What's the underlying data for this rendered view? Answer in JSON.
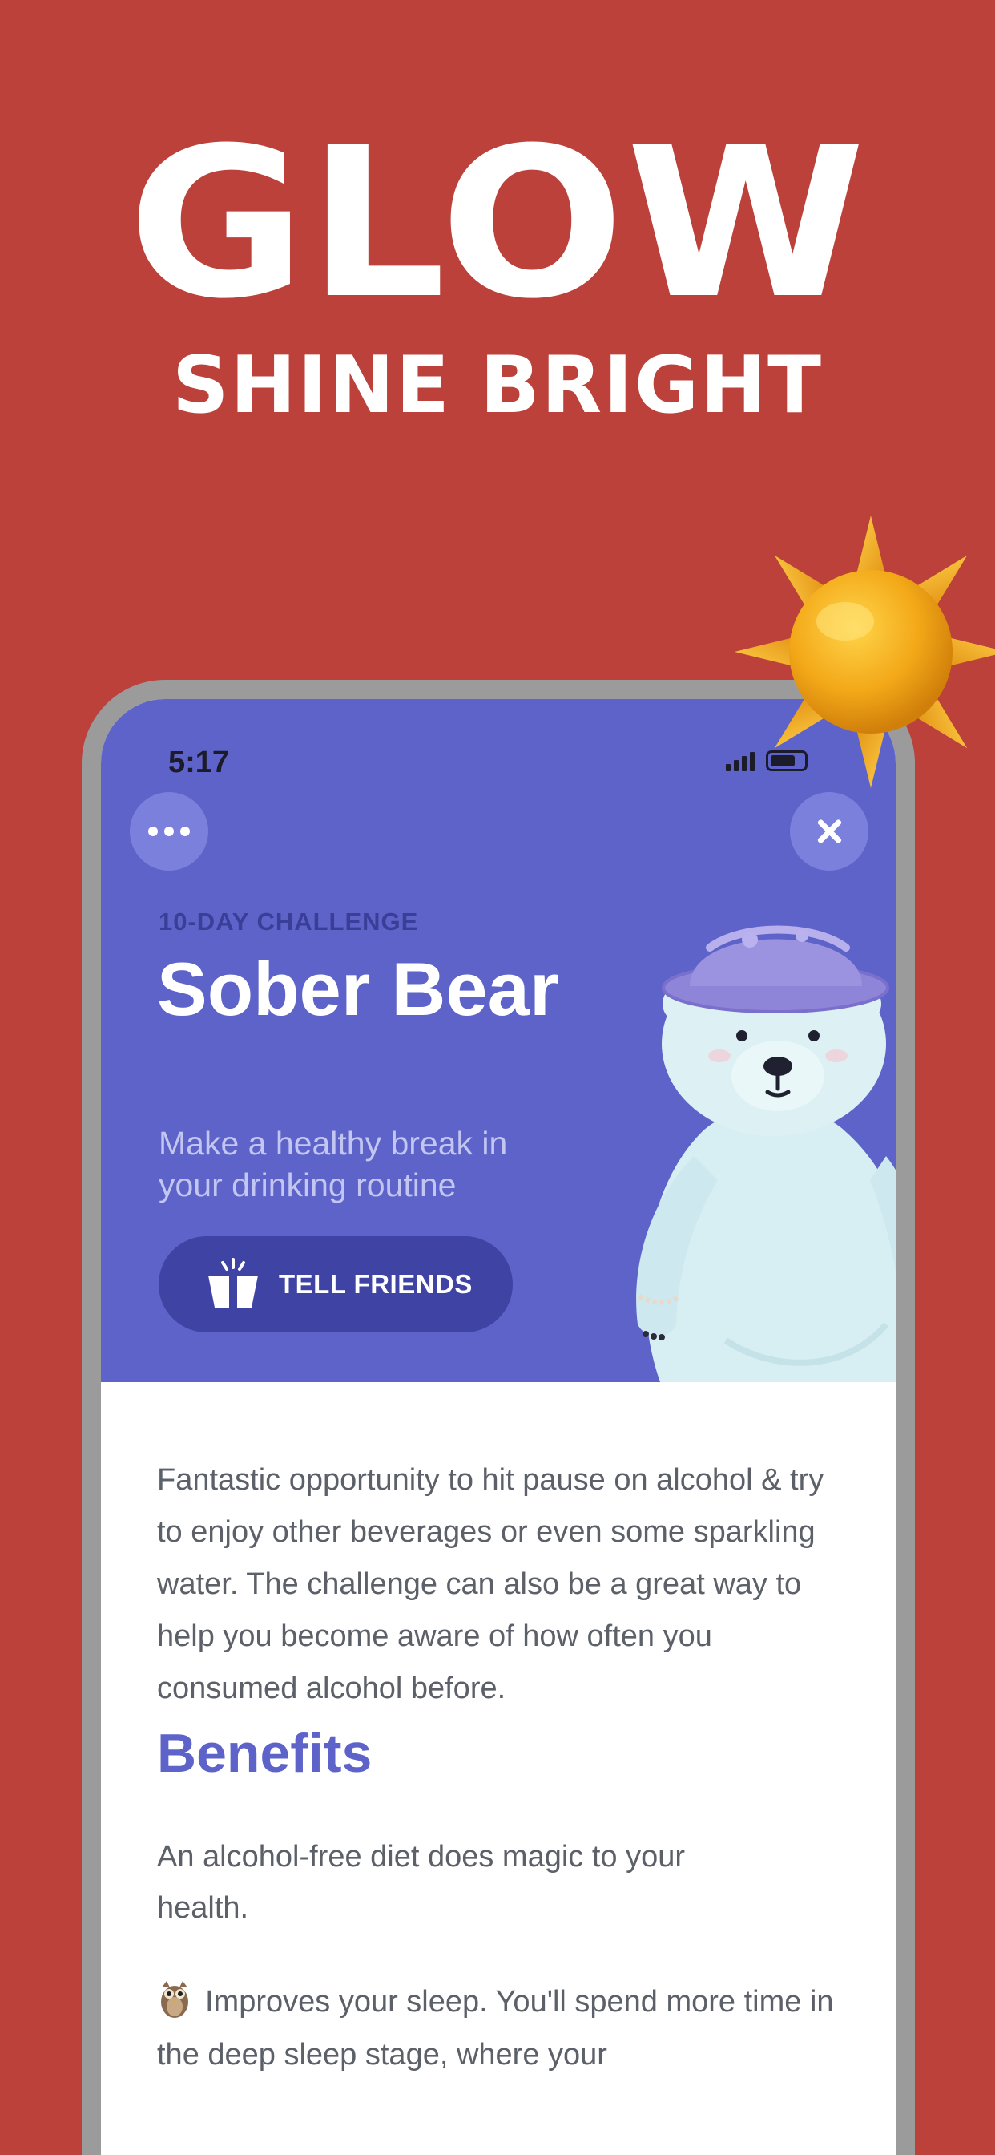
{
  "promo": {
    "title": "GLOW",
    "subtitle": "SHINE BRIGHT"
  },
  "status_bar": {
    "time": "5:17"
  },
  "hero": {
    "eyebrow": "10-DAY CHALLENGE",
    "title": "Sober Bear",
    "subtitle": "Make a healthy break in your drinking routine",
    "tell_friends_label": "TELL FRIENDS"
  },
  "content": {
    "description": "Fantastic opportunity to hit pause on alcohol & try to enjoy other beverages or even some sparkling water. The challenge can also be a great way to help you become aware of how often you consumed alcohol before.",
    "benefits_heading": "Benefits",
    "benefits_intro": "An alcohol-free diet does magic to your health.",
    "benefit_1": "Improves your sleep. You'll spend more time in the deep sleep stage, where your"
  },
  "icons": {
    "menu": "more-dots-icon",
    "close": "close-icon",
    "tell_friends": "gift-box-icon",
    "benefit_1": "owl-icon",
    "decoration": "sun-icon"
  },
  "colors": {
    "background": "#BB413A",
    "hero": "#5D63C9",
    "button": "#3E43A4",
    "accent_heading": "#5D63C9",
    "body_text": "#5C6068"
  }
}
